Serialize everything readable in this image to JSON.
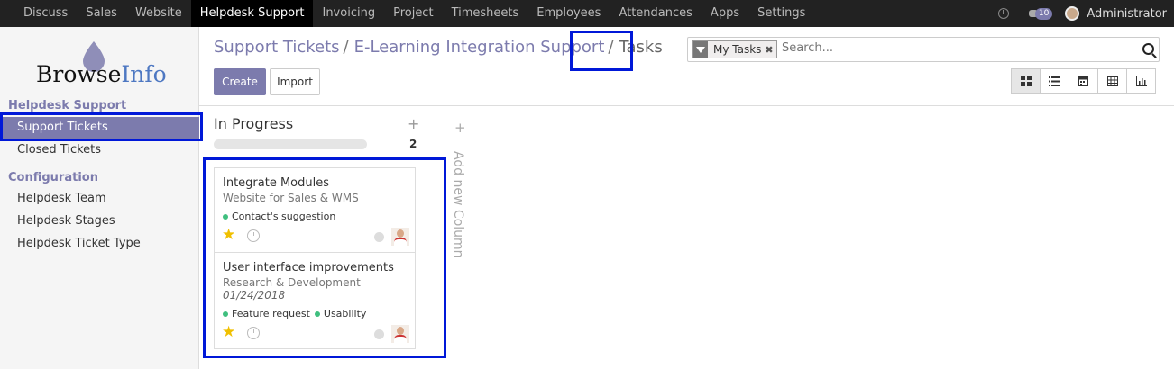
{
  "topbar": {
    "menu": [
      "Discuss",
      "Sales",
      "Website",
      "Helpdesk Support",
      "Invoicing",
      "Project",
      "Timesheets",
      "Employees",
      "Attendances",
      "Apps",
      "Settings"
    ],
    "active_index": 3,
    "chat_count": "10",
    "user": "Administrator"
  },
  "logo": {
    "part1": "Browse",
    "part2": "Info"
  },
  "sidebar": {
    "section1": "Helpdesk Support",
    "items1": [
      "Support Tickets",
      "Closed Tickets"
    ],
    "section2": "Configuration",
    "items2": [
      "Helpdesk Team",
      "Helpdesk Stages",
      "Helpdesk Ticket Type"
    ]
  },
  "breadcrumb": {
    "items": [
      "Support Tickets",
      "E-Learning Integration Support"
    ],
    "separator": "/",
    "current": "Tasks"
  },
  "buttons": {
    "create": "Create",
    "import": "Import"
  },
  "search": {
    "facet": "My Tasks",
    "placeholder": "Search..."
  },
  "kanban": {
    "column": {
      "title": "In Progress",
      "count": "2",
      "add": "+"
    },
    "add_column_label": "Add new Column",
    "cards": [
      {
        "title": "Integrate Modules",
        "project": "Website for Sales & WMS",
        "tags": [
          "Contact's suggestion"
        ]
      },
      {
        "title": "User interface improvements",
        "project": "Research & Development",
        "date": "01/24/2018",
        "tags": [
          "Feature request",
          "Usability"
        ]
      }
    ]
  },
  "colors": {
    "accent": "#7c7bad",
    "highlight": "#0018d8",
    "tag": "#3fbf7f",
    "star": "#f0c000"
  }
}
